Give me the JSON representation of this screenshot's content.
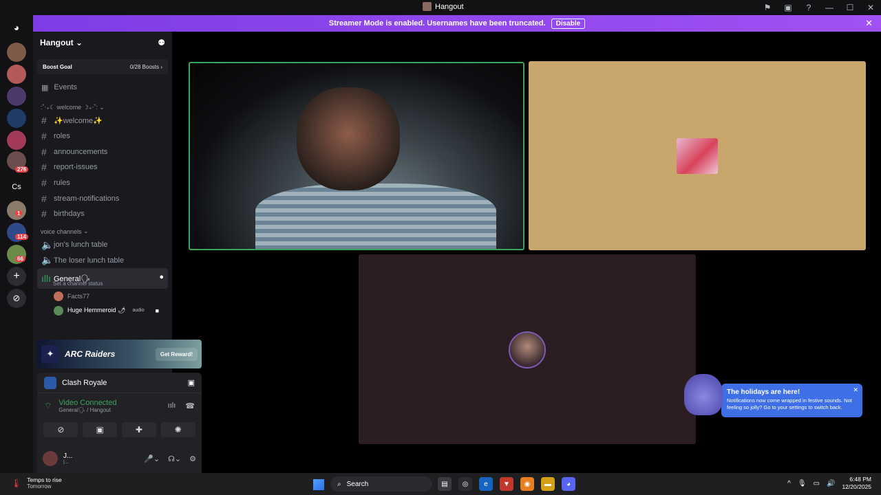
{
  "window": {
    "title": "Hangout"
  },
  "banner": {
    "text": "Streamer Mode is enabled. Usernames have been truncated.",
    "button": "Disable"
  },
  "servers": {
    "badges": [
      "276",
      "1",
      "114",
      "66"
    ],
    "cs_label": "Cs"
  },
  "sidebar": {
    "guild_name": "Hangout",
    "boost": {
      "label": "Boost Goal",
      "value": "0/28 Boosts"
    },
    "events_label": "Events",
    "text_category": ":˚‧₊☾ welcome ☽₊‧˚:",
    "channels": [
      "✨welcome✨",
      "roles",
      "announcements",
      "report-issues",
      "rules",
      "stream-notifications",
      "birthdays"
    ],
    "voice_category": "voice channels",
    "voice_channels": [
      "jon's lunch table",
      "The loser lunch table"
    ],
    "active_voice": {
      "name": "General🗣",
      "status": "Set a channel status"
    },
    "voice_users": [
      {
        "name": "Facts77",
        "tag": ""
      },
      {
        "name": "Huge Hemmeroid 🌶",
        "tag": "audio"
      }
    ]
  },
  "promo": {
    "brand": "ARC Raiders",
    "button": "Get Reward!"
  },
  "panel": {
    "activity": "Clash Royale",
    "connection": "Video Connected",
    "location": "General🗣 / Hangout"
  },
  "user": {
    "name": "J...",
    "sub": "|..."
  },
  "toast": {
    "title": "The holidays are here!",
    "body": "Notifications now come wrapped in festive sounds. Not feeling so jolly? Go to your settings to switch back."
  },
  "taskbar": {
    "weather_title": "Temps to rise",
    "weather_sub": "Tomorrow",
    "search_placeholder": "Search",
    "time": "6:48 PM",
    "date": "12/20/2025"
  },
  "colors": {
    "accent": "#a052f5",
    "connected": "#3ba55d",
    "toast": "#3e6fe6",
    "tile2": "#c9a66b",
    "tile3": "#2c1d22"
  }
}
